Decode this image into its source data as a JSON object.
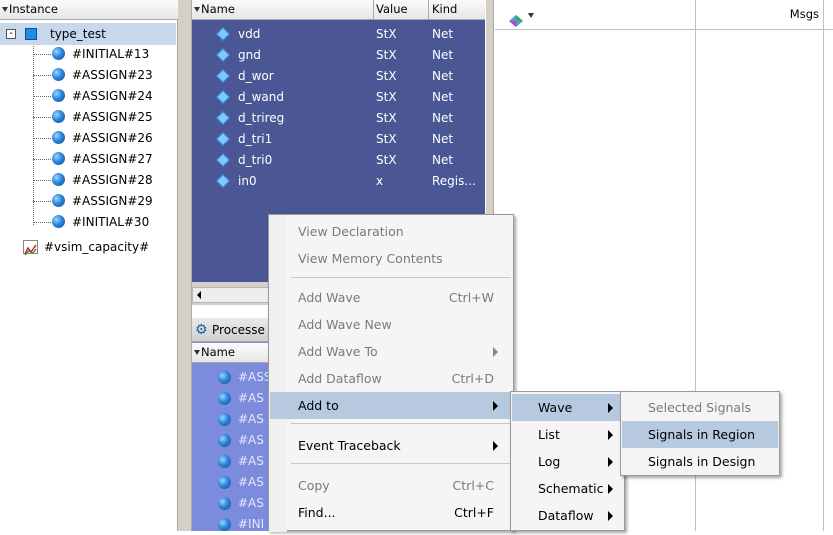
{
  "instance_panel": {
    "header": "Instance",
    "root": "type_test",
    "children": [
      "#INITIAL#13",
      "#ASSIGN#23",
      "#ASSIGN#24",
      "#ASSIGN#25",
      "#ASSIGN#26",
      "#ASSIGN#27",
      "#ASSIGN#28",
      "#ASSIGN#29",
      "#INITIAL#30"
    ],
    "extra": "#vsim_capacity#",
    "expander": "-"
  },
  "objects_panel": {
    "headers": {
      "name": "Name",
      "value": "Value",
      "kind": "Kind"
    },
    "rows": [
      {
        "name": "vdd",
        "value": "StX",
        "kind": "Net"
      },
      {
        "name": "gnd",
        "value": "StX",
        "kind": "Net"
      },
      {
        "name": "d_wor",
        "value": "StX",
        "kind": "Net"
      },
      {
        "name": "d_wand",
        "value": "StX",
        "kind": "Net"
      },
      {
        "name": "d_trireg",
        "value": "StX",
        "kind": "Net"
      },
      {
        "name": "d_tri1",
        "value": "StX",
        "kind": "Net"
      },
      {
        "name": "d_tri0",
        "value": "StX",
        "kind": "Net"
      },
      {
        "name": "in0",
        "value": "x",
        "kind": "Regis..."
      }
    ]
  },
  "processes_panel": {
    "title": "Processe",
    "header": "Name",
    "rows": [
      "#ASS",
      "#AS",
      "#AS",
      "#AS",
      "#AS",
      "#AS",
      "#AS",
      "#INI"
    ]
  },
  "wave_panel": {
    "msgs_header": "Msgs"
  },
  "context_menu": {
    "items": [
      {
        "label": "View Declaration",
        "shortcut": "",
        "disabled": true
      },
      {
        "label": "View Memory Contents",
        "shortcut": "",
        "disabled": true
      },
      {
        "label": "Add Wave",
        "shortcut": "Ctrl+W",
        "disabled": true
      },
      {
        "label": "Add Wave New",
        "shortcut": "",
        "disabled": true
      },
      {
        "label": "Add Wave To",
        "shortcut": "",
        "disabled": true
      },
      {
        "label": "Add Dataflow",
        "shortcut": "Ctrl+D",
        "disabled": true
      },
      {
        "label": "Add to",
        "shortcut": "",
        "disabled": false
      },
      {
        "label": "Event Traceback",
        "shortcut": "",
        "disabled": false
      },
      {
        "label": "Copy",
        "shortcut": "Ctrl+C",
        "disabled": true
      },
      {
        "label": "Find...",
        "shortcut": "Ctrl+F",
        "disabled": false
      }
    ]
  },
  "addto_submenu": {
    "items": [
      "Wave",
      "List",
      "Log",
      "Schematic",
      "Dataflow"
    ]
  },
  "wave_submenu": {
    "items": [
      {
        "label": "Selected Signals",
        "disabled": true
      },
      {
        "label": "Signals in Region",
        "disabled": false
      },
      {
        "label": "Signals in Design",
        "disabled": false
      }
    ]
  },
  "colors": {
    "objects_bg": "#4a5794",
    "process_bg": "#7c8bdc",
    "menu_highlight": "#b7c9df"
  }
}
